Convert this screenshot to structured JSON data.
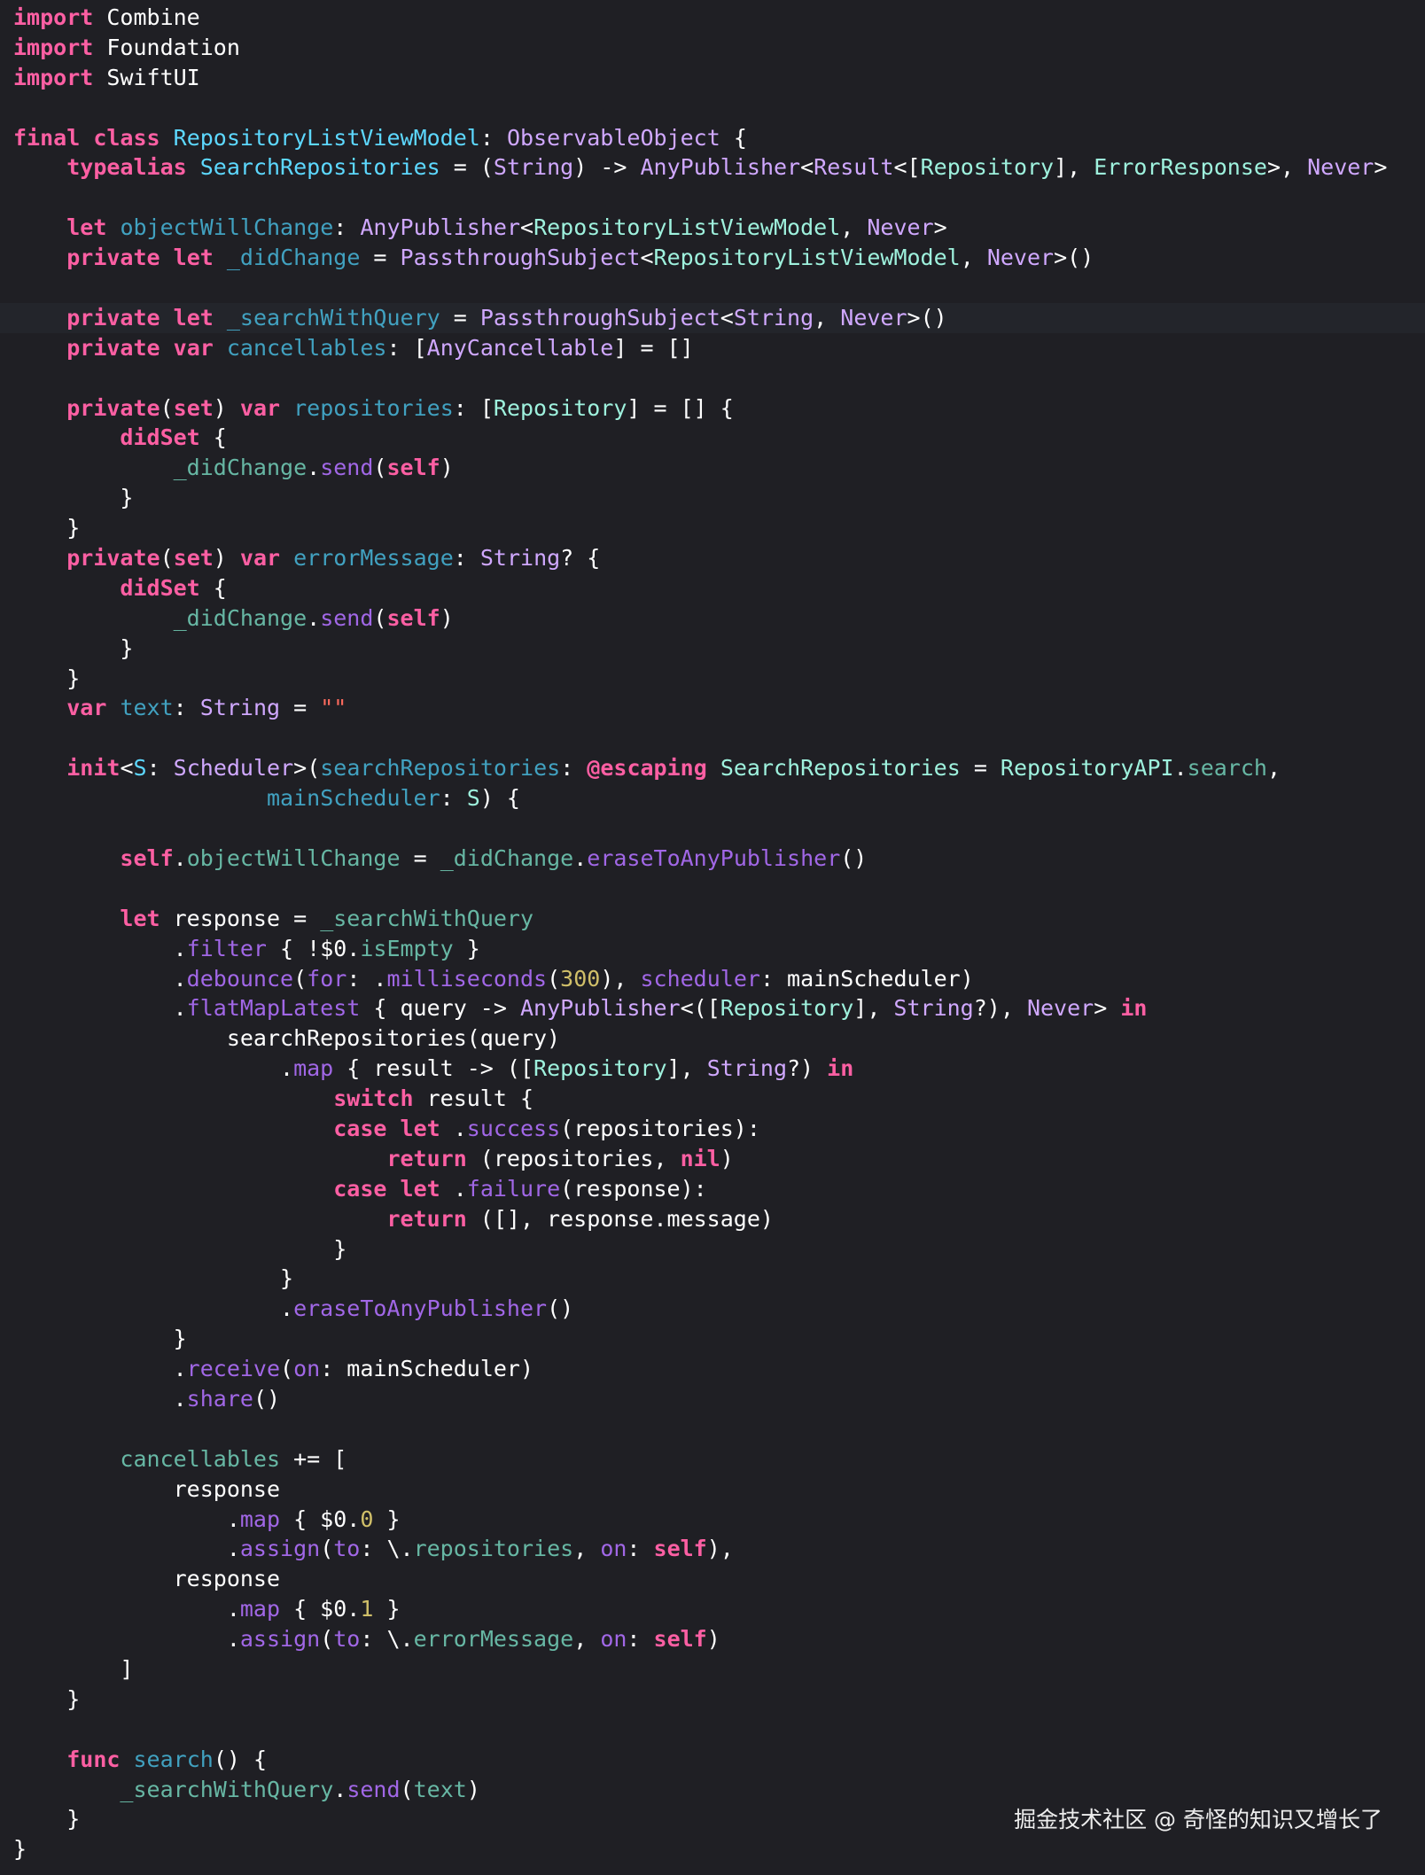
{
  "editor": {
    "background": "#1f1f24",
    "current_line_highlight": "#23252b",
    "syntax_colors": {
      "keyword": "#fc5fa3",
      "type": "#d0a8ff",
      "declared_type": "#5dd8ff",
      "declared_var": "#41a1c0",
      "project_var": "#67b7a4",
      "project_func": "#a167e6",
      "project_type": "#9ef1dd",
      "number": "#d0bf69",
      "string": "#fc6a5d",
      "plain": "#ffffff"
    },
    "current_line_index": 10,
    "lines": [
      [
        [
          "kw",
          "import"
        ],
        [
          "pl",
          " Combine"
        ]
      ],
      [
        [
          "kw",
          "import"
        ],
        [
          "pl",
          " Foundation"
        ]
      ],
      [
        [
          "kw",
          "import"
        ],
        [
          "pl",
          " SwiftUI"
        ]
      ],
      [],
      [
        [
          "kw",
          "final"
        ],
        [
          "pl",
          " "
        ],
        [
          "kw",
          "class"
        ],
        [
          "pl",
          " "
        ],
        [
          "dtp",
          "RepositoryListViewModel"
        ],
        [
          "pl",
          ": "
        ],
        [
          "tp",
          "ObservableObject"
        ],
        [
          "pl",
          " {"
        ]
      ],
      [
        [
          "pl",
          "    "
        ],
        [
          "kw",
          "typealias"
        ],
        [
          "pl",
          " "
        ],
        [
          "dtp",
          "SearchRepositories"
        ],
        [
          "pl",
          " = ("
        ],
        [
          "tp",
          "String"
        ],
        [
          "pl",
          ") -> "
        ],
        [
          "tp",
          "AnyPublisher"
        ],
        [
          "pl",
          "<"
        ],
        [
          "tp",
          "Result"
        ],
        [
          "pl",
          "<["
        ],
        [
          "ptp",
          "Repository"
        ],
        [
          "pl",
          "], "
        ],
        [
          "ptp",
          "ErrorResponse"
        ],
        [
          "pl",
          ">, "
        ],
        [
          "tp",
          "Never"
        ],
        [
          "pl",
          ">"
        ]
      ],
      [],
      [
        [
          "pl",
          "    "
        ],
        [
          "kw",
          "let"
        ],
        [
          "pl",
          " "
        ],
        [
          "dvr",
          "objectWillChange"
        ],
        [
          "pl",
          ": "
        ],
        [
          "tp",
          "AnyPublisher"
        ],
        [
          "pl",
          "<"
        ],
        [
          "ptp",
          "RepositoryListViewModel"
        ],
        [
          "pl",
          ", "
        ],
        [
          "tp",
          "Never"
        ],
        [
          "pl",
          ">"
        ]
      ],
      [
        [
          "pl",
          "    "
        ],
        [
          "kw",
          "private"
        ],
        [
          "pl",
          " "
        ],
        [
          "kw",
          "let"
        ],
        [
          "pl",
          " "
        ],
        [
          "dvr",
          "_didChange"
        ],
        [
          "pl",
          " = "
        ],
        [
          "tp",
          "PassthroughSubject"
        ],
        [
          "pl",
          "<"
        ],
        [
          "ptp",
          "RepositoryListViewModel"
        ],
        [
          "pl",
          ", "
        ],
        [
          "tp",
          "Never"
        ],
        [
          "pl",
          ">()"
        ]
      ],
      [],
      [
        [
          "pl",
          "    "
        ],
        [
          "kw",
          "private"
        ],
        [
          "pl",
          " "
        ],
        [
          "kw",
          "let"
        ],
        [
          "pl",
          " "
        ],
        [
          "dvr",
          "_searchWithQuery"
        ],
        [
          "pl",
          " = "
        ],
        [
          "tp",
          "PassthroughSubject"
        ],
        [
          "pl",
          "<"
        ],
        [
          "tp",
          "String"
        ],
        [
          "pl",
          ", "
        ],
        [
          "tp",
          "Never"
        ],
        [
          "pl",
          ">()"
        ]
      ],
      [
        [
          "pl",
          "    "
        ],
        [
          "kw",
          "private"
        ],
        [
          "pl",
          " "
        ],
        [
          "kw",
          "var"
        ],
        [
          "pl",
          " "
        ],
        [
          "dvr",
          "cancellables"
        ],
        [
          "pl",
          ": ["
        ],
        [
          "tp",
          "AnyCancellable"
        ],
        [
          "pl",
          "] = []"
        ]
      ],
      [],
      [
        [
          "pl",
          "    "
        ],
        [
          "kw",
          "private"
        ],
        [
          "pl",
          "("
        ],
        [
          "kw",
          "set"
        ],
        [
          "pl",
          ") "
        ],
        [
          "kw",
          "var"
        ],
        [
          "pl",
          " "
        ],
        [
          "dvr",
          "repositories"
        ],
        [
          "pl",
          ": ["
        ],
        [
          "ptp",
          "Repository"
        ],
        [
          "pl",
          "] = [] {"
        ]
      ],
      [
        [
          "pl",
          "        "
        ],
        [
          "kw",
          "didSet"
        ],
        [
          "pl",
          " {"
        ]
      ],
      [
        [
          "pl",
          "            "
        ],
        [
          "pvr",
          "_didChange"
        ],
        [
          "pl",
          "."
        ],
        [
          "pfn",
          "send"
        ],
        [
          "pl",
          "("
        ],
        [
          "kw",
          "self"
        ],
        [
          "pl",
          ")"
        ]
      ],
      [
        [
          "pl",
          "        }"
        ]
      ],
      [
        [
          "pl",
          "    }"
        ]
      ],
      [
        [
          "pl",
          "    "
        ],
        [
          "kw",
          "private"
        ],
        [
          "pl",
          "("
        ],
        [
          "kw",
          "set"
        ],
        [
          "pl",
          ") "
        ],
        [
          "kw",
          "var"
        ],
        [
          "pl",
          " "
        ],
        [
          "dvr",
          "errorMessage"
        ],
        [
          "pl",
          ": "
        ],
        [
          "tp",
          "String"
        ],
        [
          "pl",
          "? {"
        ]
      ],
      [
        [
          "pl",
          "        "
        ],
        [
          "kw",
          "didSet"
        ],
        [
          "pl",
          " {"
        ]
      ],
      [
        [
          "pl",
          "            "
        ],
        [
          "pvr",
          "_didChange"
        ],
        [
          "pl",
          "."
        ],
        [
          "pfn",
          "send"
        ],
        [
          "pl",
          "("
        ],
        [
          "kw",
          "self"
        ],
        [
          "pl",
          ")"
        ]
      ],
      [
        [
          "pl",
          "        }"
        ]
      ],
      [
        [
          "pl",
          "    }"
        ]
      ],
      [
        [
          "pl",
          "    "
        ],
        [
          "kw",
          "var"
        ],
        [
          "pl",
          " "
        ],
        [
          "dvr",
          "text"
        ],
        [
          "pl",
          ": "
        ],
        [
          "tp",
          "String"
        ],
        [
          "pl",
          " = "
        ],
        [
          "str",
          "\"\""
        ]
      ],
      [],
      [
        [
          "pl",
          "    "
        ],
        [
          "kw",
          "init"
        ],
        [
          "pl",
          "<"
        ],
        [
          "dtp",
          "S"
        ],
        [
          "pl",
          ": "
        ],
        [
          "tp",
          "Scheduler"
        ],
        [
          "pl",
          ">("
        ],
        [
          "dvr",
          "searchRepositories"
        ],
        [
          "pl",
          ": "
        ],
        [
          "kw",
          "@escaping"
        ],
        [
          "pl",
          " "
        ],
        [
          "ptp",
          "SearchRepositories"
        ],
        [
          "pl",
          " = "
        ],
        [
          "ptp",
          "RepositoryAPI"
        ],
        [
          "pl",
          "."
        ],
        [
          "pvr",
          "search"
        ],
        [
          "pl",
          ","
        ]
      ],
      [
        [
          "pl",
          "                   "
        ],
        [
          "dvr",
          "mainScheduler"
        ],
        [
          "pl",
          ": "
        ],
        [
          "ptp",
          "S"
        ],
        [
          "pl",
          ") {"
        ]
      ],
      [],
      [
        [
          "pl",
          "        "
        ],
        [
          "kw",
          "self"
        ],
        [
          "pl",
          "."
        ],
        [
          "pvr",
          "objectWillChange"
        ],
        [
          "pl",
          " = "
        ],
        [
          "pvr",
          "_didChange"
        ],
        [
          "pl",
          "."
        ],
        [
          "pfn",
          "eraseToAnyPublisher"
        ],
        [
          "pl",
          "()"
        ]
      ],
      [],
      [
        [
          "pl",
          "        "
        ],
        [
          "kw",
          "let"
        ],
        [
          "pl",
          " response = "
        ],
        [
          "pvr",
          "_searchWithQuery"
        ]
      ],
      [
        [
          "pl",
          "            ."
        ],
        [
          "pfn",
          "filter"
        ],
        [
          "pl",
          " { !$0."
        ],
        [
          "pvr",
          "isEmpty"
        ],
        [
          "pl",
          " }"
        ]
      ],
      [
        [
          "pl",
          "            ."
        ],
        [
          "pfn",
          "debounce"
        ],
        [
          "pl",
          "("
        ],
        [
          "pfn",
          "for"
        ],
        [
          "pl",
          ": ."
        ],
        [
          "pfn",
          "milliseconds"
        ],
        [
          "pl",
          "("
        ],
        [
          "num",
          "300"
        ],
        [
          "pl",
          "), "
        ],
        [
          "pfn",
          "scheduler"
        ],
        [
          "pl",
          ": mainScheduler)"
        ]
      ],
      [
        [
          "pl",
          "            ."
        ],
        [
          "pfn",
          "flatMapLatest"
        ],
        [
          "pl",
          " { query -> "
        ],
        [
          "tp",
          "AnyPublisher"
        ],
        [
          "pl",
          "<(["
        ],
        [
          "ptp",
          "Repository"
        ],
        [
          "pl",
          "], "
        ],
        [
          "tp",
          "String"
        ],
        [
          "pl",
          "?), "
        ],
        [
          "tp",
          "Never"
        ],
        [
          "pl",
          "> "
        ],
        [
          "kw",
          "in"
        ]
      ],
      [
        [
          "pl",
          "                searchRepositories(query)"
        ]
      ],
      [
        [
          "pl",
          "                    ."
        ],
        [
          "pfn",
          "map"
        ],
        [
          "pl",
          " { result -> (["
        ],
        [
          "ptp",
          "Repository"
        ],
        [
          "pl",
          "], "
        ],
        [
          "tp",
          "String"
        ],
        [
          "pl",
          "?) "
        ],
        [
          "kw",
          "in"
        ]
      ],
      [
        [
          "pl",
          "                        "
        ],
        [
          "kw",
          "switch"
        ],
        [
          "pl",
          " result {"
        ]
      ],
      [
        [
          "pl",
          "                        "
        ],
        [
          "kw",
          "case"
        ],
        [
          "pl",
          " "
        ],
        [
          "kw",
          "let"
        ],
        [
          "pl",
          " ."
        ],
        [
          "pfn",
          "success"
        ],
        [
          "pl",
          "(repositories):"
        ]
      ],
      [
        [
          "pl",
          "                            "
        ],
        [
          "kw",
          "return"
        ],
        [
          "pl",
          " (repositories, "
        ],
        [
          "kw",
          "nil"
        ],
        [
          "pl",
          ")"
        ]
      ],
      [
        [
          "pl",
          "                        "
        ],
        [
          "kw",
          "case"
        ],
        [
          "pl",
          " "
        ],
        [
          "kw",
          "let"
        ],
        [
          "pl",
          " ."
        ],
        [
          "pfn",
          "failure"
        ],
        [
          "pl",
          "(response):"
        ]
      ],
      [
        [
          "pl",
          "                            "
        ],
        [
          "kw",
          "return"
        ],
        [
          "pl",
          " ([], response.message)"
        ]
      ],
      [
        [
          "pl",
          "                        }"
        ]
      ],
      [
        [
          "pl",
          "                    }"
        ]
      ],
      [
        [
          "pl",
          "                    ."
        ],
        [
          "pfn",
          "eraseToAnyPublisher"
        ],
        [
          "pl",
          "()"
        ]
      ],
      [
        [
          "pl",
          "            }"
        ]
      ],
      [
        [
          "pl",
          "            ."
        ],
        [
          "pfn",
          "receive"
        ],
        [
          "pl",
          "("
        ],
        [
          "pfn",
          "on"
        ],
        [
          "pl",
          ": mainScheduler)"
        ]
      ],
      [
        [
          "pl",
          "            ."
        ],
        [
          "pfn",
          "share"
        ],
        [
          "pl",
          "()"
        ]
      ],
      [],
      [
        [
          "pl",
          "        "
        ],
        [
          "pvr",
          "cancellables"
        ],
        [
          "pl",
          " += ["
        ]
      ],
      [
        [
          "pl",
          "            response"
        ]
      ],
      [
        [
          "pl",
          "                ."
        ],
        [
          "pfn",
          "map"
        ],
        [
          "pl",
          " { $0."
        ],
        [
          "num",
          "0"
        ],
        [
          "pl",
          " }"
        ]
      ],
      [
        [
          "pl",
          "                ."
        ],
        [
          "pfn",
          "assign"
        ],
        [
          "pl",
          "("
        ],
        [
          "pfn",
          "to"
        ],
        [
          "pl",
          ": \\."
        ],
        [
          "pvr",
          "repositories"
        ],
        [
          "pl",
          ", "
        ],
        [
          "pfn",
          "on"
        ],
        [
          "pl",
          ": "
        ],
        [
          "kw",
          "self"
        ],
        [
          "pl",
          "),"
        ]
      ],
      [
        [
          "pl",
          "            response"
        ]
      ],
      [
        [
          "pl",
          "                ."
        ],
        [
          "pfn",
          "map"
        ],
        [
          "pl",
          " { $0."
        ],
        [
          "num",
          "1"
        ],
        [
          "pl",
          " }"
        ]
      ],
      [
        [
          "pl",
          "                ."
        ],
        [
          "pfn",
          "assign"
        ],
        [
          "pl",
          "("
        ],
        [
          "pfn",
          "to"
        ],
        [
          "pl",
          ": \\."
        ],
        [
          "pvr",
          "errorMessage"
        ],
        [
          "pl",
          ", "
        ],
        [
          "pfn",
          "on"
        ],
        [
          "pl",
          ": "
        ],
        [
          "kw",
          "self"
        ],
        [
          "pl",
          ")"
        ]
      ],
      [
        [
          "pl",
          "        ]"
        ]
      ],
      [
        [
          "pl",
          "    }"
        ]
      ],
      [],
      [
        [
          "pl",
          "    "
        ],
        [
          "kw",
          "func"
        ],
        [
          "pl",
          " "
        ],
        [
          "dvr",
          "search"
        ],
        [
          "pl",
          "() {"
        ]
      ],
      [
        [
          "pl",
          "        "
        ],
        [
          "pvr",
          "_searchWithQuery"
        ],
        [
          "pl",
          "."
        ],
        [
          "pfn",
          "send"
        ],
        [
          "pl",
          "("
        ],
        [
          "pvr",
          "text"
        ],
        [
          "pl",
          ")"
        ]
      ],
      [
        [
          "pl",
          "    }"
        ]
      ],
      [
        [
          "pl",
          "}"
        ]
      ]
    ]
  },
  "watermark": {
    "text": "掘金技术社区 @ 奇怪的知识又增长了"
  }
}
